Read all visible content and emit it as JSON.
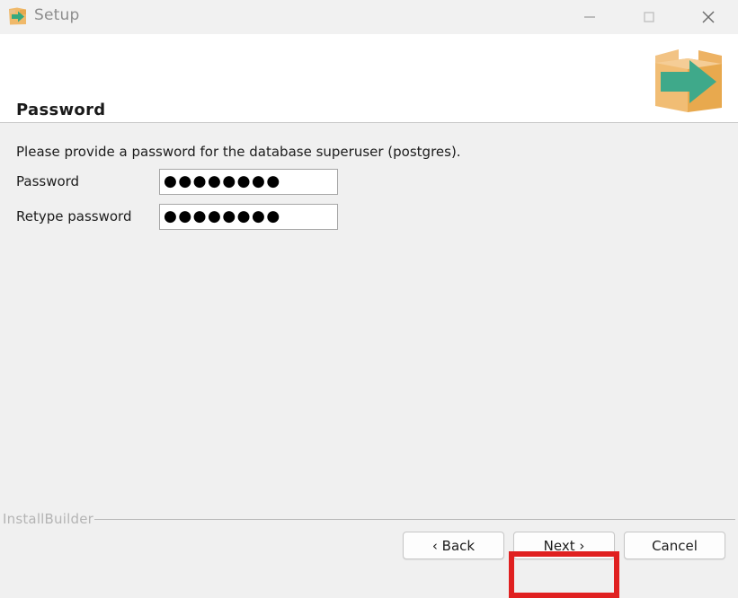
{
  "window": {
    "title": "Setup",
    "icon": "installbuilder-box-icon",
    "controls": [
      {
        "name": "minimize",
        "glyph": "minimize-icon"
      },
      {
        "name": "maximize",
        "glyph": "maximize-icon"
      },
      {
        "name": "close",
        "glyph": "close-icon"
      }
    ]
  },
  "header": {
    "title": "Password",
    "logo": "installbuilder-box-logo"
  },
  "content": {
    "intro": "Please provide a password for the database superuser (postgres).",
    "fields": [
      {
        "label": "Password",
        "value": "●●●●●●●●",
        "placeholder": ""
      },
      {
        "label": "Retype password",
        "value": "●●●●●●●●",
        "placeholder": ""
      }
    ]
  },
  "footer": {
    "brand": "InstallBuilder",
    "buttons": {
      "back": "‹  Back",
      "next": "Next  ›",
      "cancel": "Cancel"
    }
  },
  "annotation": {
    "target": "next-button",
    "color": "#e02020"
  },
  "colors": {
    "titlebar_bg": "#f1f1f1",
    "header_bg": "#ffffff",
    "content_bg": "#f0f0f0",
    "box_orange": "#f0b96a",
    "arrow_green": "#4bab8b",
    "text": "#1c1c1c",
    "muted_text": "#b4b4b4",
    "highlight": "#e02020"
  }
}
